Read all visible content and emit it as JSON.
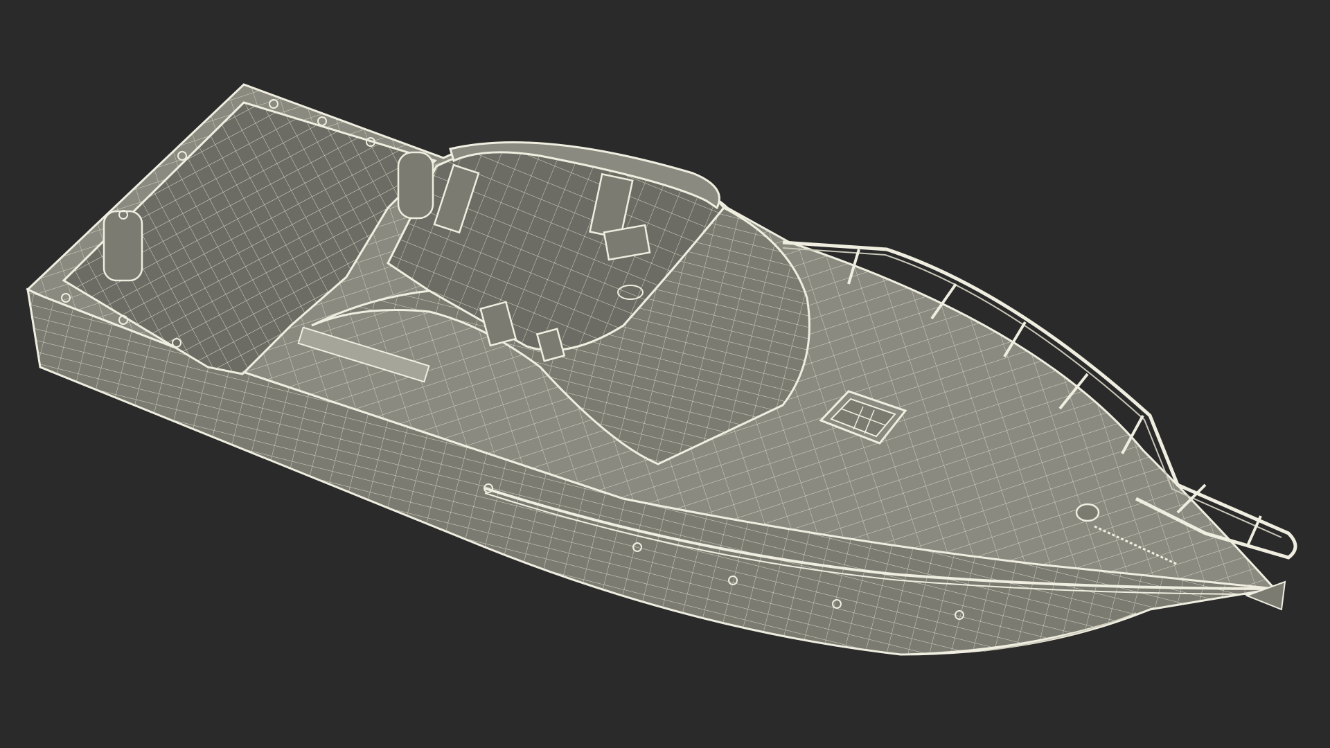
{
  "scene": {
    "subject": "boat-wireframe-render",
    "background_color": "#2a2a2a",
    "hull_fill_color": "#7b7b72",
    "hull_fill_light": "#8a8a80",
    "interior_fill_color": "#6c6c64",
    "wire_color": "#e8e6d6",
    "outline_color": "#f0eee0",
    "icons": {
      "boat": "boat-wireframe",
      "hatch": "deck-hatch-icon",
      "railing": "bow-railing",
      "seat": "helm-seat",
      "anchor": "anchor-winch-icon"
    }
  }
}
